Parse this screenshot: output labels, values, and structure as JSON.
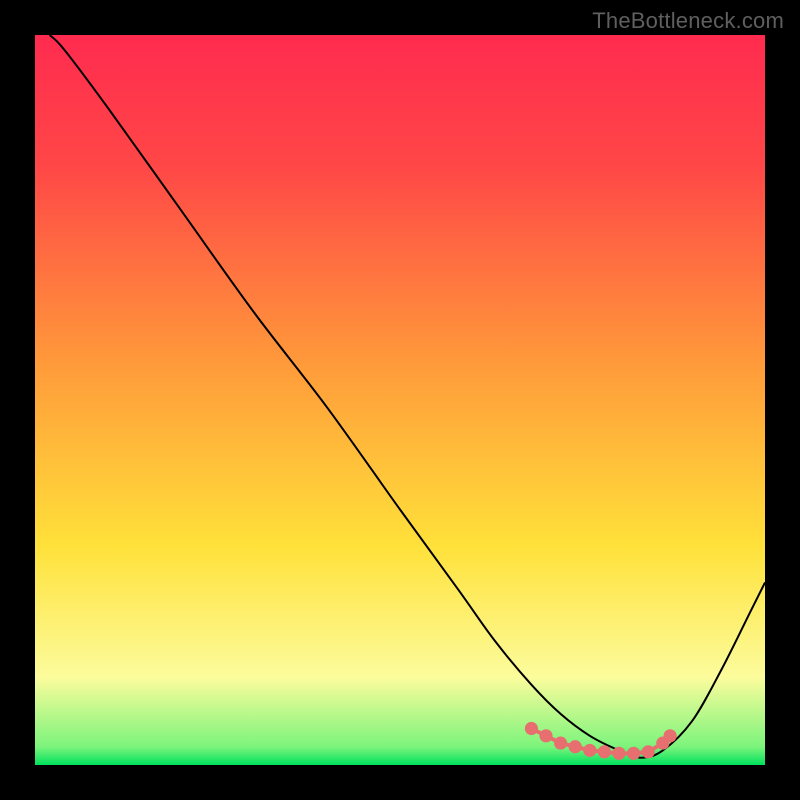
{
  "watermark": {
    "text": "TheBottleneck.com"
  },
  "colors": {
    "red": "#ff2b4f",
    "orange": "#ff8a3a",
    "yellow": "#ffe13a",
    "pale_yellow": "#fcfc9c",
    "green": "#00e25d",
    "curve": "#000000",
    "marker": "#e86f6f",
    "background": "#000000"
  },
  "chart_data": {
    "type": "line",
    "title": "",
    "xlabel": "",
    "ylabel": "",
    "xlim": [
      0,
      100
    ],
    "ylim": [
      0,
      100
    ],
    "series": [
      {
        "name": "bottleneck-curve",
        "x": [
          2,
          4,
          10,
          20,
          30,
          40,
          50,
          58,
          63,
          68,
          72,
          76,
          80,
          83,
          86,
          90,
          94,
          98,
          100
        ],
        "y": [
          100,
          98,
          90,
          76,
          62,
          49,
          35,
          24,
          17,
          11,
          7,
          4,
          2,
          1,
          2,
          6,
          13,
          21,
          25
        ]
      }
    ],
    "markers": {
      "name": "optimal-zone-markers",
      "x": [
        68,
        70,
        72,
        74,
        76,
        78,
        80,
        82,
        84,
        86,
        87
      ],
      "y": [
        5,
        4,
        3,
        2.5,
        2,
        1.8,
        1.6,
        1.6,
        1.8,
        3,
        4
      ]
    },
    "gradient_stops": [
      {
        "pos": 0.0,
        "color": "#ff2b4f"
      },
      {
        "pos": 0.18,
        "color": "#ff4747"
      },
      {
        "pos": 0.45,
        "color": "#ff9a3a"
      },
      {
        "pos": 0.7,
        "color": "#ffe13a"
      },
      {
        "pos": 0.88,
        "color": "#fcfc9c"
      },
      {
        "pos": 0.975,
        "color": "#7cf47c"
      },
      {
        "pos": 1.0,
        "color": "#00e25d"
      }
    ]
  }
}
